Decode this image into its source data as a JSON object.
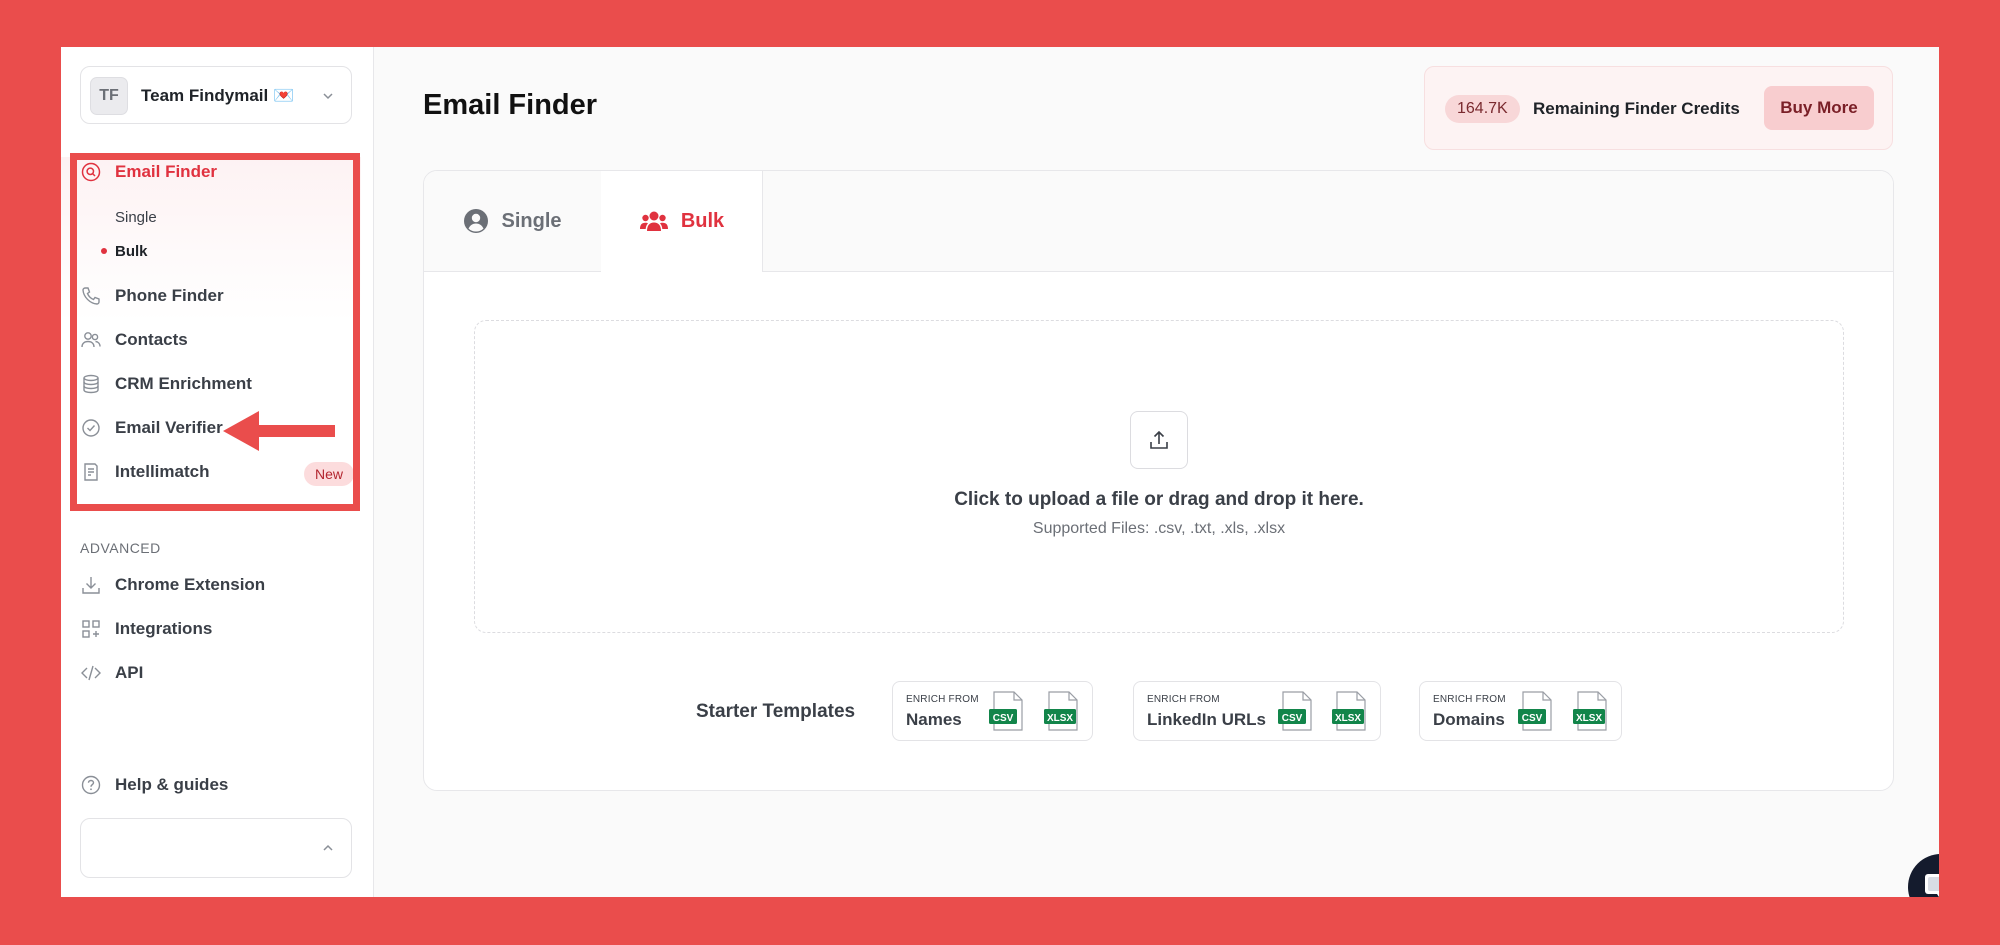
{
  "team": {
    "initials": "TF",
    "name": "Team Findymail 💌"
  },
  "nav": {
    "email_finder": "Email Finder",
    "sub_single": "Single",
    "sub_bulk": "Bulk",
    "phone_finder": "Phone Finder",
    "contacts": "Contacts",
    "crm_enrichment": "CRM Enrichment",
    "email_verifier": "Email Verifier",
    "intellimatch": "Intellimatch",
    "new_badge": "New",
    "advanced_label": "ADVANCED",
    "chrome_extension": "Chrome Extension",
    "integrations": "Integrations",
    "api": "API",
    "help": "Help & guides"
  },
  "header": {
    "title": "Email Finder",
    "credits_value": "164.7K",
    "credits_label": "Remaining Finder Credits",
    "buy_more": "Buy More"
  },
  "tabs": {
    "single": "Single",
    "bulk": "Bulk",
    "active": "Bulk"
  },
  "upload": {
    "main_text": "Click to upload a file or drag and drop it here.",
    "supported": "Supported Files: .csv, .txt, .xls, .xlsx"
  },
  "templates": {
    "label": "Starter Templates",
    "items": [
      {
        "prefix": "ENRICH FROM",
        "name": "Names",
        "csv": "CSV",
        "xlsx": "XLSX"
      },
      {
        "prefix": "ENRICH FROM",
        "name": "LinkedIn URLs",
        "csv": "CSV",
        "xlsx": "XLSX"
      },
      {
        "prefix": "ENRICH FROM",
        "name": "Domains",
        "csv": "CSV",
        "xlsx": "XLSX"
      }
    ]
  },
  "colors": {
    "accent": "#e0323f",
    "annotation": "#ea4d4c",
    "chat": "#141b2d"
  }
}
